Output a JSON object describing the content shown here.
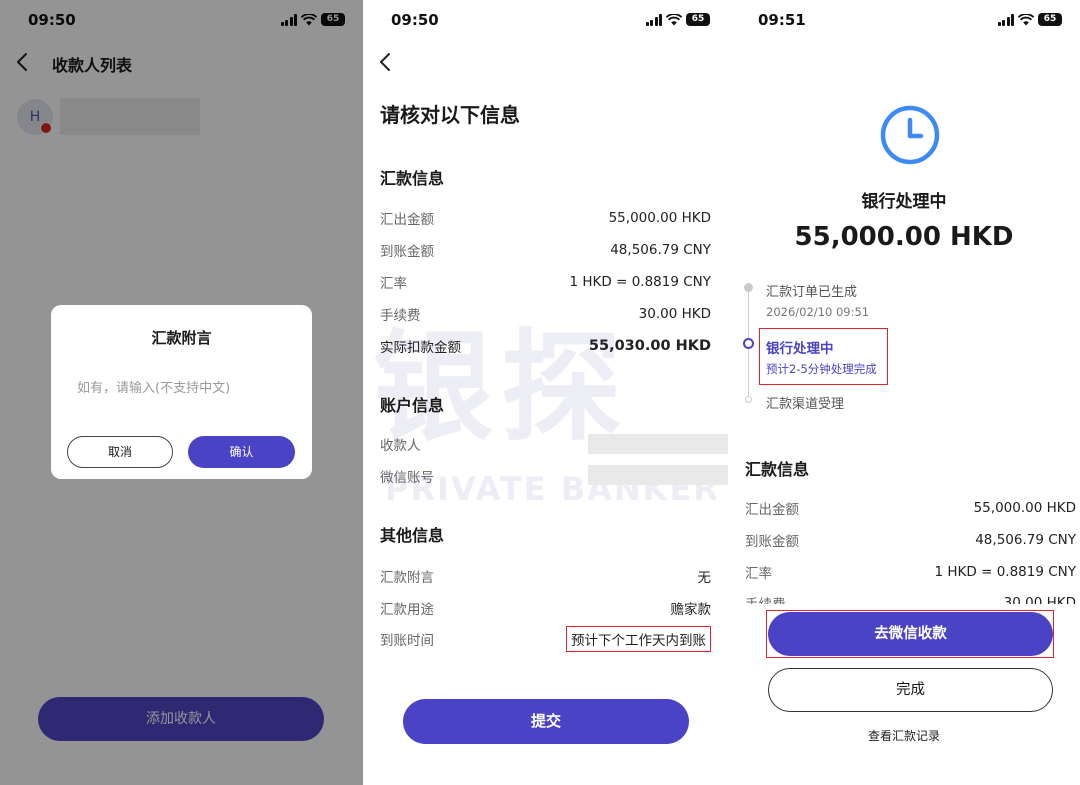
{
  "status_bars": [
    {
      "time": "09:50",
      "battery": "65"
    },
    {
      "time": "09:50",
      "battery": "65"
    },
    {
      "time": "09:51",
      "battery": "65"
    }
  ],
  "screen1": {
    "title": "收款人列表",
    "avatar_letter": "H",
    "add_button": "添加收款人",
    "dialog": {
      "title": "汇款附言",
      "placeholder": "如有，请输入(不支持中文)",
      "cancel": "取消",
      "confirm": "确认"
    }
  },
  "screen2": {
    "title": "请核对以下信息",
    "remittance_section": "汇款信息",
    "remittance_rows": [
      {
        "label": "汇出金额",
        "value": "55,000.00 HKD"
      },
      {
        "label": "到账金额",
        "value": "48,506.79 CNY"
      },
      {
        "label": "汇率",
        "value": "1 HKD = 0.8819 CNY"
      },
      {
        "label": "手续费",
        "value": "30.00 HKD"
      },
      {
        "label": "实际扣款金额",
        "value": "55,030.00 HKD"
      }
    ],
    "account_section": "账户信息",
    "account_rows": [
      {
        "label": "收款人"
      },
      {
        "label": "微信账号"
      }
    ],
    "other_section": "其他信息",
    "other_rows": [
      {
        "label": "汇款附言",
        "value": "无"
      },
      {
        "label": "汇款用途",
        "value": "赡家款"
      },
      {
        "label": "到账时间",
        "value": "预计下个工作天内到账"
      }
    ],
    "submit": "提交",
    "watermark_big": "银探",
    "watermark_small": "PRIVATE BANKER",
    "accent": "#4b43c6",
    "highlight_color": "#e0262a"
  },
  "screen3": {
    "status_title": "银行处理中",
    "amount": "55,000.00 HKD",
    "timeline": {
      "step1": "汇款订单已生成",
      "step1_time": "2026/02/10 09:51",
      "step2": "银行处理中",
      "step2_note": "预计2-5分钟处理完成",
      "step3": "汇款渠道受理"
    },
    "section": "汇款信息",
    "rows": [
      {
        "label": "汇出金额",
        "value": "55,000.00 HKD"
      },
      {
        "label": "到账金额",
        "value": "48,506.79 CNY"
      },
      {
        "label": "汇率",
        "value": "1 HKD = 0.8819 CNY"
      },
      {
        "label": "手续费",
        "value": "30.00 HKD"
      }
    ],
    "wechat_button": "去微信收款",
    "done_button": "完成",
    "history_link": "查看汇款记录",
    "clock_color": "#3d8af7"
  }
}
